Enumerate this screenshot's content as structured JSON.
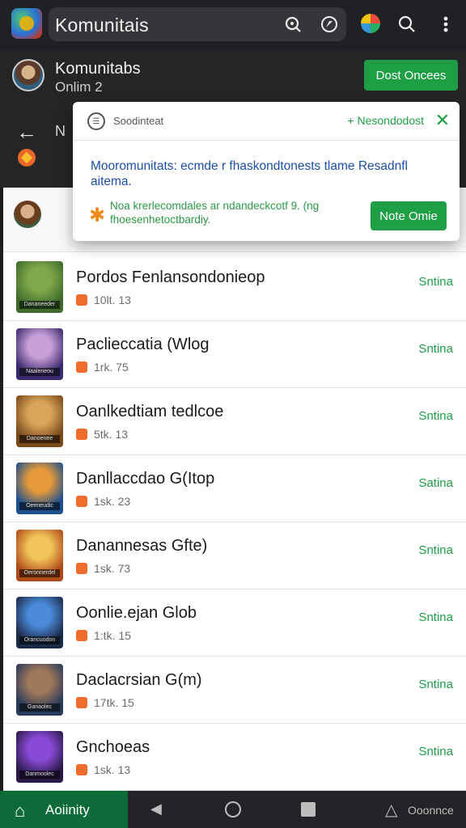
{
  "topbar": {
    "title": "Komunitais",
    "icons": [
      "search-icon",
      "compass-icon",
      "search-icon",
      "more-vert-icon"
    ]
  },
  "header": {
    "name": "Komunitabs",
    "status": "Onlim 2",
    "action_label": "Dost Oncees",
    "sub_label": "N"
  },
  "popup": {
    "head_label": "Soodinteat",
    "head_link": "+ Nesondodost",
    "message": "Mooromunitats: ecmde r fhaskondtonests tlame Resadnfl aitema.",
    "note": "Noa krerlecomdales ar ndandeckcotf 9. (ng fhoesenhetoctbardiy.",
    "action_label": "Note Omie"
  },
  "rows": [
    {
      "title": "Pordos Fenlansondonieop",
      "meta": "10lt. 13",
      "status": "Sntina",
      "thumb_caption": "Dananeeder"
    },
    {
      "title": "Paclieccatia (Wlog",
      "meta": "1rk. 75",
      "status": "Sntina",
      "thumb_caption": "Naaleneou"
    },
    {
      "title": "Oanlkedtiam tedlcoe",
      "meta": "5tk. 13",
      "status": "Sntina",
      "thumb_caption": "Danoenee"
    },
    {
      "title": "Danllaccdao G(Itop",
      "meta": "1sk. 23",
      "status": "Satina",
      "thumb_caption": "Oeeneudic"
    },
    {
      "title": "Danannesas Gfte)",
      "meta": "1sk. 73",
      "status": "Sntina",
      "thumb_caption": "Oeronnerdel"
    },
    {
      "title": "Oonlie.ejan Glob",
      "meta": "1:tk. 15",
      "status": "Sntina",
      "thumb_caption": "Orancuodon"
    },
    {
      "title": "Daclacrsian G(m)",
      "meta": "17tk. 15",
      "status": "Sntina",
      "thumb_caption": "Ganaolec"
    },
    {
      "title": "Gnchoeas",
      "meta": "1sk. 13",
      "status": "Sntina",
      "thumb_caption": "Danmoolec"
    }
  ],
  "thumb_colors": [
    [
      "#3f6b2d",
      "#7fa84a"
    ],
    [
      "#3a2a6e",
      "#c9a0d8"
    ],
    [
      "#7a4a1c",
      "#d9a55a"
    ],
    [
      "#1f4f8c",
      "#e69a3a"
    ],
    [
      "#b04a1a",
      "#f2c55a"
    ],
    [
      "#1c2a4a",
      "#4a8ad8"
    ],
    [
      "#2a3a5a",
      "#a0785a"
    ],
    [
      "#2a1a4a",
      "#8a4ad8"
    ]
  ],
  "bottombar": {
    "active_label": "Aoiinity",
    "right_label": "Ooonnce"
  },
  "colors": {
    "accent_green": "#1e9e45",
    "link_blue": "#1d4fa8",
    "orange": "#ef6c2c"
  }
}
